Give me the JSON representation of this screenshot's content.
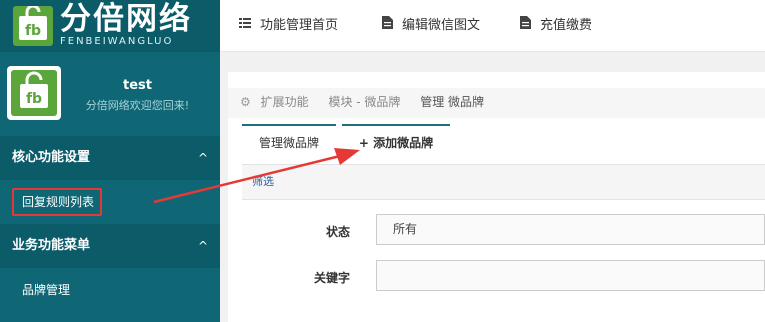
{
  "logo": {
    "title": "分倍网络",
    "subtitle": "FENBEIWANGLUO",
    "brand_color": "#5aa63b"
  },
  "user": {
    "name": "test",
    "welcome": "分倍网络欢迎您回来!"
  },
  "sidebar": {
    "sections": [
      {
        "title": "核心功能设置",
        "chevron": "^",
        "items": [
          {
            "label": "回复规则列表",
            "highlighted": true
          }
        ]
      },
      {
        "title": "业务功能菜单",
        "chevron": "^",
        "items": [
          {
            "label": "品牌管理"
          }
        ]
      }
    ]
  },
  "topnav": {
    "items": [
      {
        "label": "功能管理首页",
        "icon": "list-icon"
      },
      {
        "label": "编辑微信图文",
        "icon": "document-icon"
      },
      {
        "label": "充值缴费",
        "icon": "document-icon"
      }
    ]
  },
  "breadcrumb": {
    "items": [
      "扩展功能",
      "模块 - 微品牌"
    ],
    "current": "管理 微品牌"
  },
  "tabs": [
    {
      "label": "管理微品牌",
      "active": true
    },
    {
      "label": "+ 添加微品牌",
      "active": false
    }
  ],
  "filter": {
    "label": "筛选"
  },
  "form": {
    "status_label": "状态",
    "status_value": "所有",
    "keyword_label": "关键字",
    "keyword_value": ""
  },
  "colors": {
    "sidebar": "#0f6675",
    "sidebar_dark": "#0b5b69",
    "annotation": "#e53935"
  }
}
